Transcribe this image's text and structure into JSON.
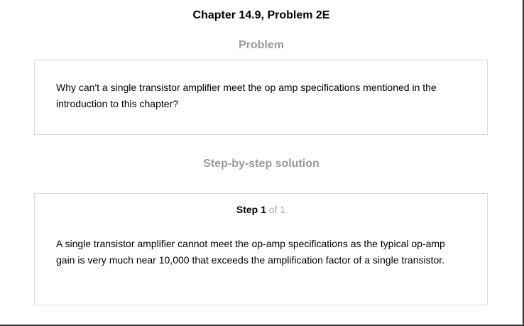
{
  "page": {
    "title": "Chapter 14.9, Problem 2E"
  },
  "problem": {
    "heading": "Problem",
    "text": "Why can't a single transistor amplifier meet the op amp specifications mentioned in the introduction to this chapter?"
  },
  "solution": {
    "heading": "Step-by-step solution",
    "step": {
      "label": "Step",
      "number": "1",
      "of_total": "of 1"
    },
    "text": "A single transistor amplifier cannot meet the op-amp specifications as the typical op-amp gain is very much near 10,000 that exceeds the amplification factor of a single transistor."
  }
}
